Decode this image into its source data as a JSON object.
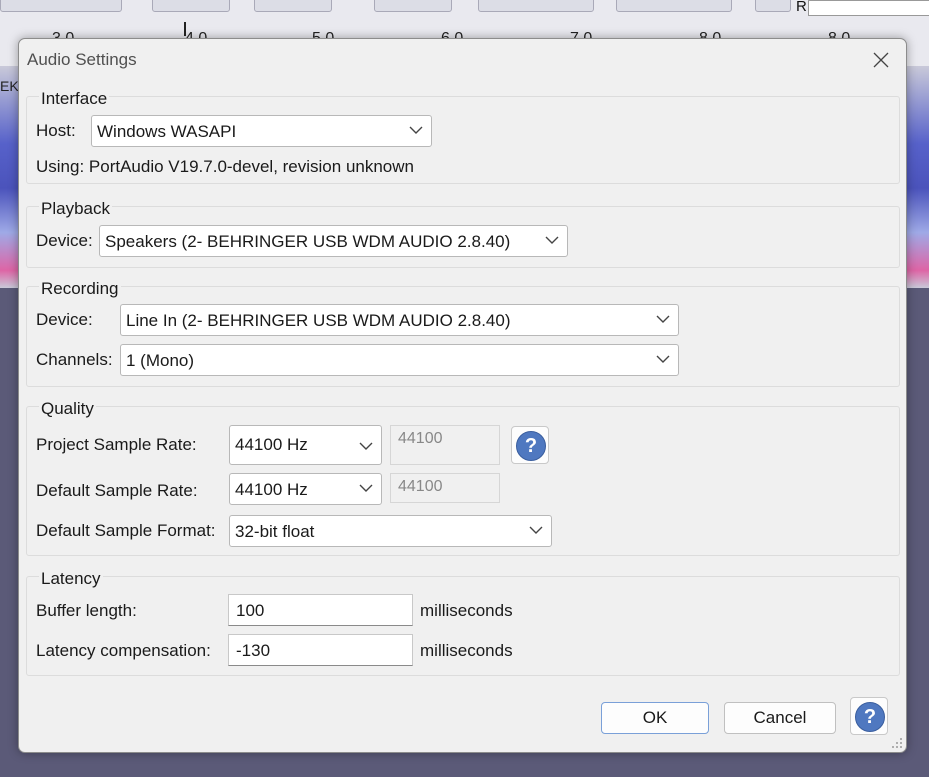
{
  "background": {
    "ruler_ticks": [
      "3.0",
      "4.0",
      "5.0",
      "6.0",
      "7.0",
      "8.0"
    ],
    "track_label": "EK",
    "channel_letter": "R"
  },
  "dialog": {
    "title": "Audio Settings",
    "close_icon": "close-icon",
    "interface": {
      "title": "Interface",
      "host_label": "Host:",
      "host_value": "Windows WASAPI",
      "using_text": "Using: PortAudio V19.7.0-devel, revision unknown"
    },
    "playback": {
      "title": "Playback",
      "device_label": "Device:",
      "device_value": "Speakers (2- BEHRINGER USB WDM AUDIO 2.8.40)"
    },
    "recording": {
      "title": "Recording",
      "device_label": "Device:",
      "device_value": "Line In (2- BEHRINGER USB WDM AUDIO 2.8.40)",
      "channels_label": "Channels:",
      "channels_value": "1 (Mono)"
    },
    "quality": {
      "title": "Quality",
      "project_rate_label": "Project Sample Rate:",
      "project_rate_value": "44100 Hz",
      "project_rate_custom": "44100",
      "default_rate_label": "Default Sample Rate:",
      "default_rate_value": "44100 Hz",
      "default_rate_custom": "44100",
      "default_format_label": "Default Sample Format:",
      "default_format_value": "32-bit float",
      "help_glyph": "?"
    },
    "latency": {
      "title": "Latency",
      "buffer_label": "Buffer length:",
      "buffer_value": "100",
      "buffer_unit": "milliseconds",
      "compensation_label": "Latency compensation:",
      "compensation_value": "-130",
      "compensation_unit": "milliseconds"
    },
    "footer": {
      "ok_label": "OK",
      "cancel_label": "Cancel",
      "help_glyph": "?"
    }
  },
  "colors": {
    "dialog_bg": "#f0f0f0",
    "help_blue": "#4f78c0",
    "backdrop": "#5b5a78"
  }
}
